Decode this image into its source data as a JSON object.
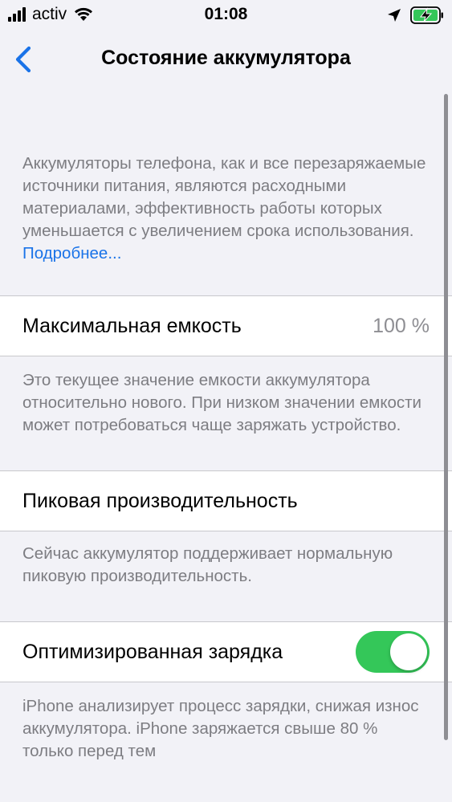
{
  "status_bar": {
    "carrier": "activ",
    "time": "01:08"
  },
  "nav": {
    "title": "Состояние аккумулятора"
  },
  "intro": {
    "text": "Аккумуляторы телефона, как и все перезаряжаемые источники питания, являются расходными материалами, эффективность работы которых уменьшается с увеличением срока использования. ",
    "link": "Подробнее..."
  },
  "max_capacity": {
    "label": "Максимальная емкость",
    "value": "100 %",
    "footer": "Это текущее значение емкости аккумулятора относительно нового. При низком значении емкости может потребоваться чаще заряжать устройство."
  },
  "peak_performance": {
    "label": "Пиковая производительность",
    "footer": "Сейчас аккумулятор поддерживает нормальную пиковую производительность."
  },
  "optimized_charging": {
    "label": "Оптимизированная зарядка",
    "enabled": true,
    "footer": "iPhone анализирует процесс зарядки, снижая износ аккумулятора. iPhone заряжается свыше 80 % только перед тем"
  },
  "colors": {
    "accent": "#1a73e8",
    "toggle_on": "#34c759",
    "battery_charging": "#34c759"
  },
  "icons": [
    "signal-icon",
    "wifi-icon",
    "location-arrow-icon",
    "battery-charging-icon",
    "chevron-left-icon"
  ]
}
